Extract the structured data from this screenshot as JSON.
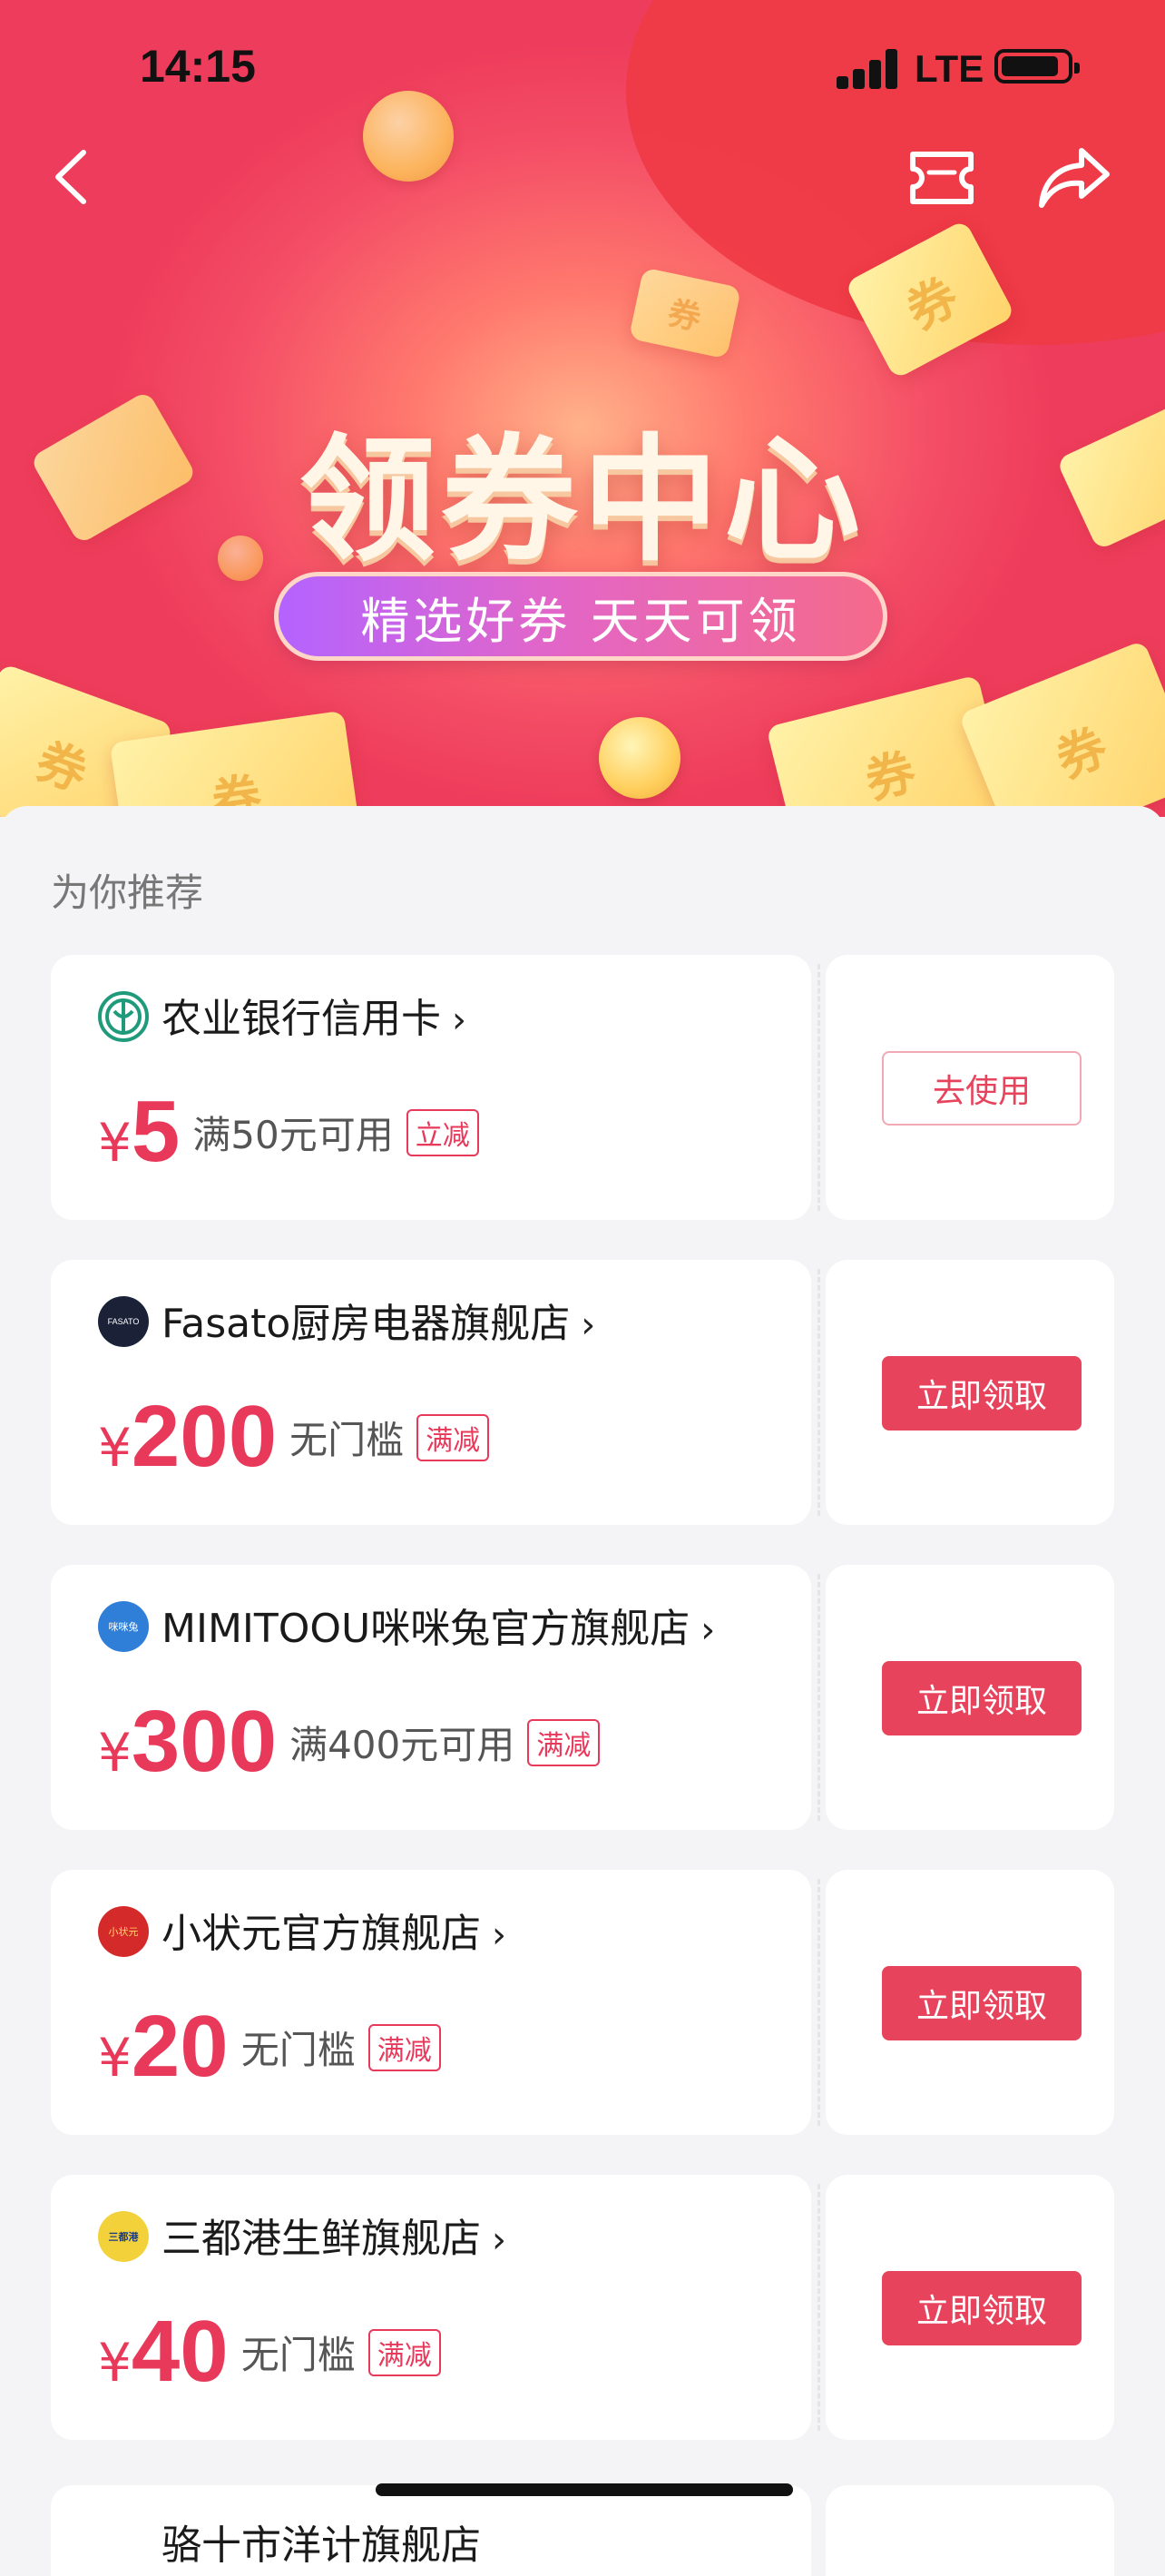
{
  "status_bar": {
    "time": "14:15",
    "network": "LTE"
  },
  "nav": {
    "back_icon": "chevron-left-icon",
    "ticket_icon": "ticket-icon",
    "share_icon": "share-icon"
  },
  "banner": {
    "title": "领券中心",
    "subtitle": "精选好券 天天可领",
    "coupon_glyph": "券"
  },
  "section": {
    "title": "为你推荐"
  },
  "colors": {
    "accent": "#e8435c",
    "price": "#e8395a",
    "banner_red": "#ef3a45",
    "coupon_gold": "#ffd36a"
  },
  "coupons": [
    {
      "store": "农业银行信用卡",
      "logo": "abc-bank-logo",
      "currency": "¥",
      "amount": "5",
      "condition": "满50元可用",
      "tag": "立减",
      "button": "去使用",
      "button_style": "outline"
    },
    {
      "store": "Fasato厨房电器旗舰店",
      "logo": "fasato-logo",
      "logo_text": "FASATO",
      "currency": "¥",
      "amount": "200",
      "condition": "无门槛",
      "tag": "满减",
      "button": "立即领取",
      "button_style": "primary"
    },
    {
      "store": "MIMITOOU咪咪兔官方旗舰店",
      "logo": "mimitoou-logo",
      "logo_text": "咪咪兔",
      "currency": "¥",
      "amount": "300",
      "condition": "满400元可用",
      "tag": "满减",
      "button": "立即领取",
      "button_style": "primary"
    },
    {
      "store": "小状元官方旗舰店",
      "logo": "xiaozhuangyuan-logo",
      "logo_text": "小状元",
      "currency": "¥",
      "amount": "20",
      "condition": "无门槛",
      "tag": "满减",
      "button": "立即领取",
      "button_style": "primary"
    },
    {
      "store": "三都港生鲜旗舰店",
      "logo": "sandugang-logo",
      "logo_text": "三都港",
      "currency": "¥",
      "amount": "40",
      "condition": "无门槛",
      "tag": "满减",
      "button": "立即领取",
      "button_style": "primary"
    }
  ],
  "partial": {
    "store": "骆十市洋计旗舰店"
  }
}
